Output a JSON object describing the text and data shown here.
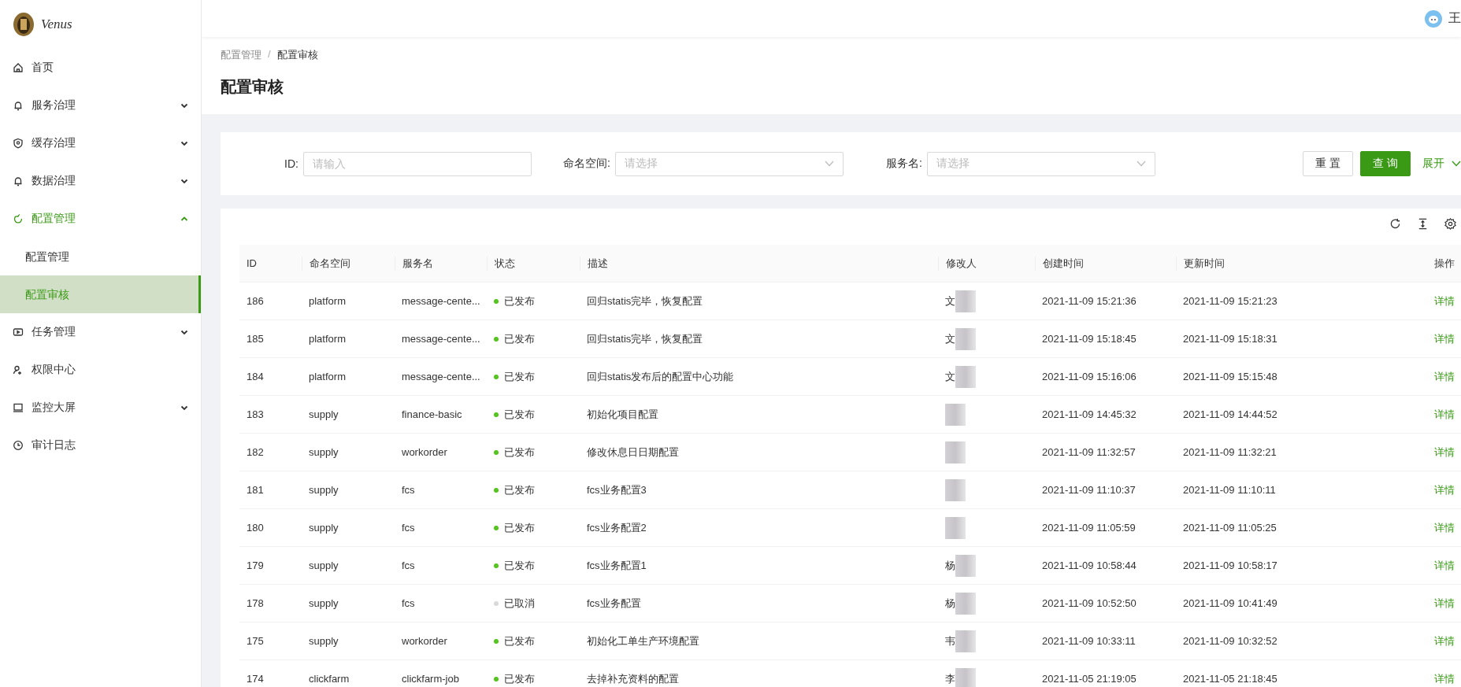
{
  "logo": {
    "text": "Venus"
  },
  "top_bar": {
    "user": "王"
  },
  "sidebar": {
    "items": [
      {
        "label": "首页",
        "selected": false
      },
      {
        "label": "服务治理",
        "selected": false,
        "expanded": false
      },
      {
        "label": "缓存治理",
        "selected": false,
        "expanded": false
      },
      {
        "label": "数据治理",
        "selected": false,
        "expanded": false
      },
      {
        "label": "配置管理",
        "selected": false,
        "expanded": true,
        "children": [
          {
            "label": "配置管理",
            "selected": false
          },
          {
            "label": "配置审核",
            "selected": true
          }
        ]
      },
      {
        "label": "任务管理",
        "selected": false,
        "expanded": false
      },
      {
        "label": "权限中心",
        "selected": false
      },
      {
        "label": "监控大屏",
        "selected": false,
        "expanded": false
      },
      {
        "label": "审计日志",
        "selected": false
      }
    ]
  },
  "breadcrumb": [
    "配置管理",
    "/",
    "配置审核"
  ],
  "page_title": "配置审核",
  "filters": {
    "fields": [
      {
        "label": "ID:",
        "kind": "input",
        "placeholder": "请输入"
      },
      {
        "label": "命名空间:",
        "kind": "select",
        "placeholder": "请选择"
      },
      {
        "label": "服务名:",
        "kind": "select",
        "placeholder": "请选择"
      }
    ],
    "buttons": [
      {
        "label": "重 置",
        "kind": "default"
      },
      {
        "label": "查 询",
        "kind": "primary"
      }
    ],
    "expand_link": "展开"
  },
  "table": {
    "columns": [
      "ID",
      "命名空间",
      "服务名",
      "状态",
      "描述",
      "修改人",
      "创建时间",
      "更新时间",
      "操作"
    ],
    "rows": [
      {
        "id": "186",
        "namespace": "platform",
        "service": "message-cente...",
        "status": "已发布",
        "color": "#52c41a",
        "description": "回归statis完毕，恢复配置",
        "modifier": "文",
        "redacted": true,
        "created": "2021-11-09 15:21:36",
        "updated": "2021-11-09 15:21:23",
        "action": "详情"
      },
      {
        "id": "185",
        "namespace": "platform",
        "service": "message-cente...",
        "status": "已发布",
        "color": "#52c41a",
        "description": "回归statis完毕，恢复配置",
        "modifier": "文",
        "redacted": true,
        "created": "2021-11-09 15:18:45",
        "updated": "2021-11-09 15:18:31",
        "action": "详情"
      },
      {
        "id": "184",
        "namespace": "platform",
        "service": "message-cente...",
        "status": "已发布",
        "color": "#52c41a",
        "description": "回归statis发布后的配置中心功能",
        "modifier": "文",
        "redacted": true,
        "created": "2021-11-09 15:16:06",
        "updated": "2021-11-09 15:15:48",
        "action": "详情"
      },
      {
        "id": "183",
        "namespace": "supply",
        "service": "finance-basic",
        "status": "已发布",
        "color": "#52c41a",
        "description": "初始化项目配置",
        "redacted": true,
        "created": "2021-11-09 14:45:32",
        "updated": "2021-11-09 14:44:52",
        "action": "详情"
      },
      {
        "id": "182",
        "namespace": "supply",
        "service": "workorder",
        "status": "已发布",
        "color": "#52c41a",
        "description": "修改休息日日期配置",
        "redacted": true,
        "created": "2021-11-09 11:32:57",
        "updated": "2021-11-09 11:32:21",
        "action": "详情"
      },
      {
        "id": "181",
        "namespace": "supply",
        "service": "fcs",
        "status": "已发布",
        "color": "#52c41a",
        "description": "fcs业务配置3",
        "redacted": true,
        "created": "2021-11-09 11:10:37",
        "updated": "2021-11-09 11:10:11",
        "action": "详情"
      },
      {
        "id": "180",
        "namespace": "supply",
        "service": "fcs",
        "status": "已发布",
        "color": "#52c41a",
        "description": "fcs业务配置2",
        "redacted": true,
        "created": "2021-11-09 11:05:59",
        "updated": "2021-11-09 11:05:25",
        "action": "详情"
      },
      {
        "id": "179",
        "namespace": "supply",
        "service": "fcs",
        "status": "已发布",
        "color": "#52c41a",
        "description": "fcs业务配置1",
        "modifier": "杨",
        "redacted": true,
        "created": "2021-11-09 10:58:44",
        "updated": "2021-11-09 10:58:17",
        "action": "详情"
      },
      {
        "id": "178",
        "namespace": "supply",
        "service": "fcs",
        "status": "已取消",
        "color": "#d9d9d9",
        "description": "fcs业务配置",
        "modifier": "杨",
        "redacted": true,
        "created": "2021-11-09 10:52:50",
        "updated": "2021-11-09 10:41:49",
        "action": "详情"
      },
      {
        "id": "175",
        "namespace": "supply",
        "service": "workorder",
        "status": "已发布",
        "color": "#52c41a",
        "description": "初始化工单生产环境配置",
        "modifier": "韦",
        "redacted": true,
        "created": "2021-11-09 10:33:11",
        "updated": "2021-11-09 10:32:52",
        "action": "详情"
      },
      {
        "id": "174",
        "namespace": "clickfarm",
        "service": "clickfarm-job",
        "status": "已发布",
        "color": "#52c41a",
        "description": "去掉补充资料的配置",
        "modifier": "李",
        "redacted": true,
        "created": "2021-11-05 21:19:05",
        "updated": "2021-11-05 21:18:45",
        "action": "详情"
      }
    ]
  }
}
